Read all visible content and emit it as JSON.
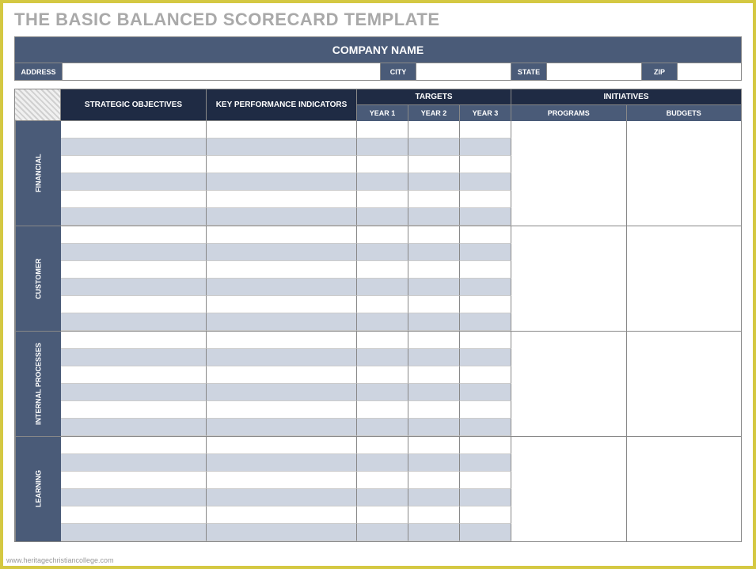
{
  "title": "THE BASIC BALANCED SCORECARD TEMPLATE",
  "company_header": "COMPANY NAME",
  "address_labels": {
    "address": "ADDRESS",
    "city": "CITY",
    "state": "STATE",
    "zip": "ZIP"
  },
  "columns": {
    "strategic_objectives": "STRATEGIC OBJECTIVES",
    "kpi": "KEY PERFORMANCE INDICATORS",
    "targets": "TARGETS",
    "year1": "YEAR 1",
    "year2": "YEAR 2",
    "year3": "YEAR 3",
    "initiatives": "INITIATIVES",
    "programs": "PROGRAMS",
    "budgets": "BUDGETS"
  },
  "sections": [
    {
      "label": "FINANCIAL",
      "rows": 6
    },
    {
      "label": "CUSTOMER",
      "rows": 6
    },
    {
      "label": "INTERNAL PROCESSES",
      "rows": 6
    },
    {
      "label": "LEARNING",
      "rows": 6
    }
  ],
  "watermark": "www.heritagechristiancollege.com"
}
